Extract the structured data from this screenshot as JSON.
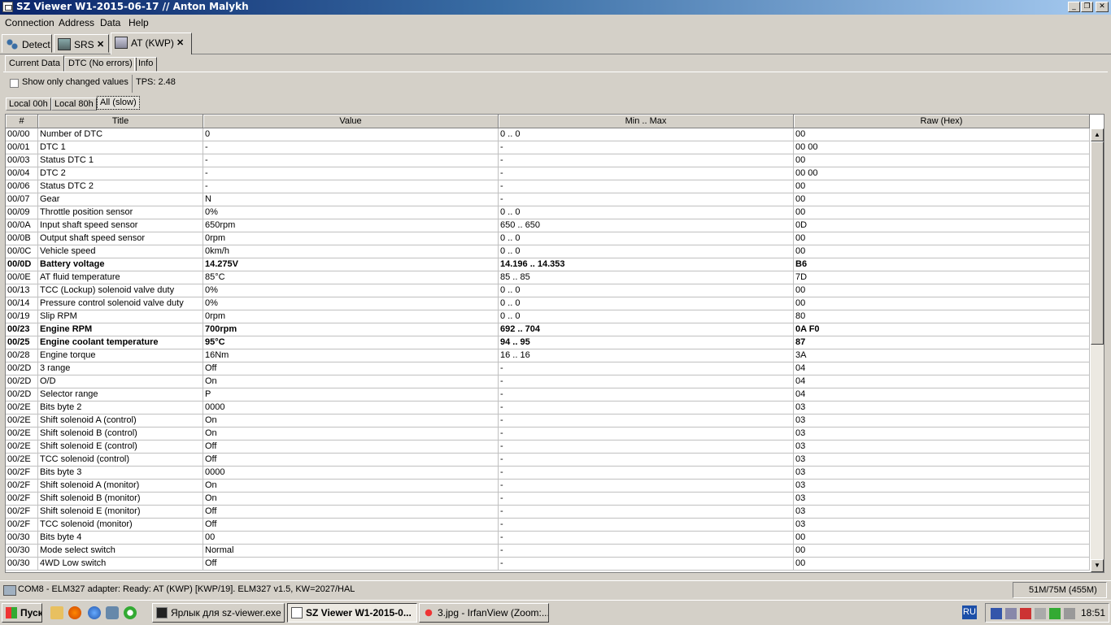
{
  "window": {
    "title": "SZ Viewer W1-2015-06-17 // Anton Malykh",
    "controls": {
      "minimize": "_",
      "maximize": "❐",
      "close": "✕"
    }
  },
  "menu": [
    "Connection",
    "Address",
    "Data",
    "Help"
  ],
  "device_tabs": [
    {
      "label": "Detect",
      "icon": "detect-icon"
    },
    {
      "label": "SRS",
      "icon": "srs-icon",
      "close": "✕"
    },
    {
      "label": "AT (KWP)",
      "icon": "at-icon",
      "close": "✕"
    }
  ],
  "data_tabs": [
    "Current Data",
    "DTC (No errors)",
    "Info"
  ],
  "options": {
    "show_changed_label": "Show only changed values",
    "show_changed_checked": false,
    "tps": "TPS: 2.48"
  },
  "block_tabs": [
    "Local 00h",
    "Local 80h",
    "All (slow)"
  ],
  "table": {
    "headers": [
      "#",
      "Title",
      "Value",
      "Min .. Max",
      "Raw (Hex)"
    ],
    "rows": [
      {
        "id": "00/00",
        "title": "Number of DTC",
        "value": "0",
        "minmax": "0 .. 0",
        "raw": "00",
        "bold": false
      },
      {
        "id": "00/01",
        "title": "DTC 1",
        "value": "-",
        "minmax": "-",
        "raw": "00 00",
        "bold": false
      },
      {
        "id": "00/03",
        "title": "Status DTC 1",
        "value": "-",
        "minmax": "-",
        "raw": "00",
        "bold": false
      },
      {
        "id": "00/04",
        "title": "DTC 2",
        "value": "-",
        "minmax": "-",
        "raw": "00 00",
        "bold": false
      },
      {
        "id": "00/06",
        "title": "Status DTC 2",
        "value": "-",
        "minmax": "-",
        "raw": "00",
        "bold": false
      },
      {
        "id": "00/07",
        "title": "Gear",
        "value": "N",
        "minmax": "-",
        "raw": "00",
        "bold": false
      },
      {
        "id": "00/09",
        "title": "Throttle position sensor",
        "value": "0%",
        "minmax": "0 .. 0",
        "raw": "00",
        "bold": false
      },
      {
        "id": "00/0A",
        "title": "Input shaft speed sensor",
        "value": "650rpm",
        "minmax": "650 .. 650",
        "raw": "0D",
        "bold": false
      },
      {
        "id": "00/0B",
        "title": "Output shaft speed sensor",
        "value": "0rpm",
        "minmax": "0 .. 0",
        "raw": "00",
        "bold": false
      },
      {
        "id": "00/0C",
        "title": "Vehicle speed",
        "value": "0km/h",
        "minmax": "0 .. 0",
        "raw": "00",
        "bold": false
      },
      {
        "id": "00/0D",
        "title": "Battery voltage",
        "value": "14.275V",
        "minmax": "14.196 .. 14.353",
        "raw": "B6",
        "bold": true
      },
      {
        "id": "00/0E",
        "title": "AT fluid temperature",
        "value": "85°C",
        "minmax": "85 .. 85",
        "raw": "7D",
        "bold": false
      },
      {
        "id": "00/13",
        "title": "TCC (Lockup) solenoid valve duty",
        "value": "0%",
        "minmax": "0 .. 0",
        "raw": "00",
        "bold": false
      },
      {
        "id": "00/14",
        "title": "Pressure control solenoid valve duty",
        "value": "0%",
        "minmax": "0 .. 0",
        "raw": "00",
        "bold": false
      },
      {
        "id": "00/19",
        "title": "Slip RPM",
        "value": "0rpm",
        "minmax": "0 .. 0",
        "raw": "80",
        "bold": false
      },
      {
        "id": "00/23",
        "title": "Engine RPM",
        "value": "700rpm",
        "minmax": "692 .. 704",
        "raw": "0A F0",
        "bold": true
      },
      {
        "id": "00/25",
        "title": "Engine coolant temperature",
        "value": "95°C",
        "minmax": "94 .. 95",
        "raw": "87",
        "bold": true
      },
      {
        "id": "00/28",
        "title": "Engine torque",
        "value": "16Nm",
        "minmax": "16 .. 16",
        "raw": "3A",
        "bold": false
      },
      {
        "id": "00/2D",
        "title": "3 range",
        "value": "Off",
        "minmax": "-",
        "raw": "04",
        "bold": false
      },
      {
        "id": "00/2D",
        "title": "O/D",
        "value": "On",
        "minmax": "-",
        "raw": "04",
        "bold": false
      },
      {
        "id": "00/2D",
        "title": "Selector range",
        "value": "P",
        "minmax": "-",
        "raw": "04",
        "bold": false
      },
      {
        "id": "00/2E",
        "title": "Bits byte 2",
        "value": "0000",
        "minmax": "-",
        "raw": "03",
        "bold": false
      },
      {
        "id": "00/2E",
        "title": "Shift solenoid A (control)",
        "value": "On",
        "minmax": "-",
        "raw": "03",
        "bold": false
      },
      {
        "id": "00/2E",
        "title": "Shift solenoid B (control)",
        "value": "On",
        "minmax": "-",
        "raw": "03",
        "bold": false
      },
      {
        "id": "00/2E",
        "title": "Shift solenoid E (control)",
        "value": "Off",
        "minmax": "-",
        "raw": "03",
        "bold": false
      },
      {
        "id": "00/2E",
        "title": "TCC solenoid (control)",
        "value": "Off",
        "minmax": "-",
        "raw": "03",
        "bold": false
      },
      {
        "id": "00/2F",
        "title": "Bits byte 3",
        "value": "0000",
        "minmax": "-",
        "raw": "03",
        "bold": false
      },
      {
        "id": "00/2F",
        "title": "Shift solenoid A (monitor)",
        "value": "On",
        "minmax": "-",
        "raw": "03",
        "bold": false
      },
      {
        "id": "00/2F",
        "title": "Shift solenoid B (monitor)",
        "value": "On",
        "minmax": "-",
        "raw": "03",
        "bold": false
      },
      {
        "id": "00/2F",
        "title": "Shift solenoid E (monitor)",
        "value": "Off",
        "minmax": "-",
        "raw": "03",
        "bold": false
      },
      {
        "id": "00/2F",
        "title": "TCC solenoid (monitor)",
        "value": "Off",
        "minmax": "-",
        "raw": "03",
        "bold": false
      },
      {
        "id": "00/30",
        "title": "Bits byte 4",
        "value": "00",
        "minmax": "-",
        "raw": "00",
        "bold": false
      },
      {
        "id": "00/30",
        "title": "Mode select switch",
        "value": "Normal",
        "minmax": "-",
        "raw": "00",
        "bold": false
      },
      {
        "id": "00/30",
        "title": "4WD Low switch",
        "value": "Off",
        "minmax": "-",
        "raw": "00",
        "bold": false
      }
    ]
  },
  "status": {
    "text": "COM8 - ELM327 adapter: Ready: AT (KWP) [KWP/19]. ELM327 v1.5, KW=2027/HAL",
    "memory": "51M/75M (455M)"
  },
  "taskbar": {
    "start": "Пуск",
    "tasks": [
      {
        "label": "Ярлык для sz-viewer.exe",
        "active": false
      },
      {
        "label": "SZ Viewer W1-2015-0...",
        "active": true
      },
      {
        "label": "3.jpg - IrfanView (Zoom:...",
        "active": false
      }
    ],
    "lang": "RU",
    "clock": "18:51"
  },
  "colors": {
    "title_gradient_start": "#0a246a",
    "title_gradient_end": "#a6caf0",
    "face": "#d4d0c8",
    "grid_line": "#c0c0c0"
  }
}
